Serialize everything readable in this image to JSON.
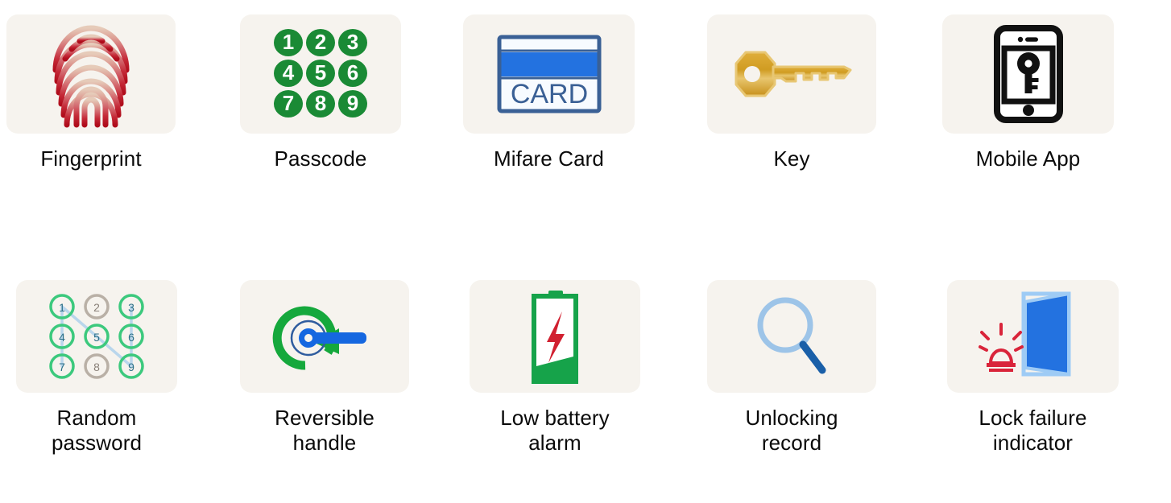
{
  "page": {
    "background_color": "#ffffff",
    "card_background_color": "#f6f3ee",
    "text_color": "#0a0a0a"
  },
  "features": {
    "row1": [
      {
        "id": "fingerprint",
        "label": "Fingerprint",
        "icon": "fingerprint-icon",
        "colors": {
          "light": "#e8c8b8",
          "mid": "#d4595f",
          "dark": "#c01020"
        }
      },
      {
        "id": "passcode",
        "label": "Passcode",
        "icon": "passcode-keypad-icon",
        "digits": [
          "1",
          "2",
          "3",
          "4",
          "5",
          "6",
          "7",
          "8",
          "9"
        ],
        "colors": {
          "circle": "#1a8a35",
          "digit": "#ffffff"
        }
      },
      {
        "id": "mifare-card",
        "label": "Mifare Card",
        "icon": "mifare-card-icon",
        "card_text": "CARD",
        "colors": {
          "stripe": "#2372e0",
          "outline": "#2f5c9e",
          "body": "#f4f8ff"
        }
      },
      {
        "id": "key",
        "label": "Key",
        "icon": "key-icon",
        "colors": {
          "body": "#cf9a20",
          "highlight": "#e8c060",
          "outline": "#b8861a"
        }
      },
      {
        "id": "mobile-app",
        "label": "Mobile App",
        "icon": "mobile-app-key-icon",
        "colors": {
          "outline": "#111111",
          "screen": "#ffffff"
        }
      }
    ],
    "row2": [
      {
        "id": "random-password",
        "label": "Random\npassword",
        "icon": "pattern-lock-icon",
        "dots": [
          "1",
          "2",
          "3",
          "4",
          "5",
          "6",
          "7",
          "8",
          "9"
        ],
        "active_dots": [
          "1",
          "3",
          "4",
          "5",
          "6",
          "7",
          "9"
        ],
        "inactive_dots": [
          "2",
          "8"
        ],
        "colors": {
          "active": "#3cc97d",
          "inactive": "#b9b0a6",
          "digit": "#2b6f87",
          "path": "#b9d6ec"
        }
      },
      {
        "id": "reversible-handle",
        "label": "Reversible\nhandle",
        "icon": "reversible-handle-icon",
        "colors": {
          "arrow": "#15a83c",
          "handle": "#1567e0",
          "ring": "#2f5c9e"
        }
      },
      {
        "id": "low-battery-alarm",
        "label": "Low battery\nalarm",
        "icon": "low-battery-icon",
        "battery_level_percent": 25,
        "colors": {
          "outline": "#16a34a",
          "fill": "#16a34a",
          "bolt": "#d12030"
        }
      },
      {
        "id": "unlocking-record",
        "label": "Unlocking\nrecord",
        "icon": "magnifier-icon",
        "colors": {
          "lens": "#9dc4e8",
          "handle": "#1a5fa8"
        }
      },
      {
        "id": "lock-failure-indicator",
        "label": "Lock failure\nindicator",
        "icon": "door-alarm-icon",
        "colors": {
          "door": "#2372e0",
          "frame": "#9ecbf5",
          "alarm": "#d9243a"
        }
      }
    ]
  }
}
